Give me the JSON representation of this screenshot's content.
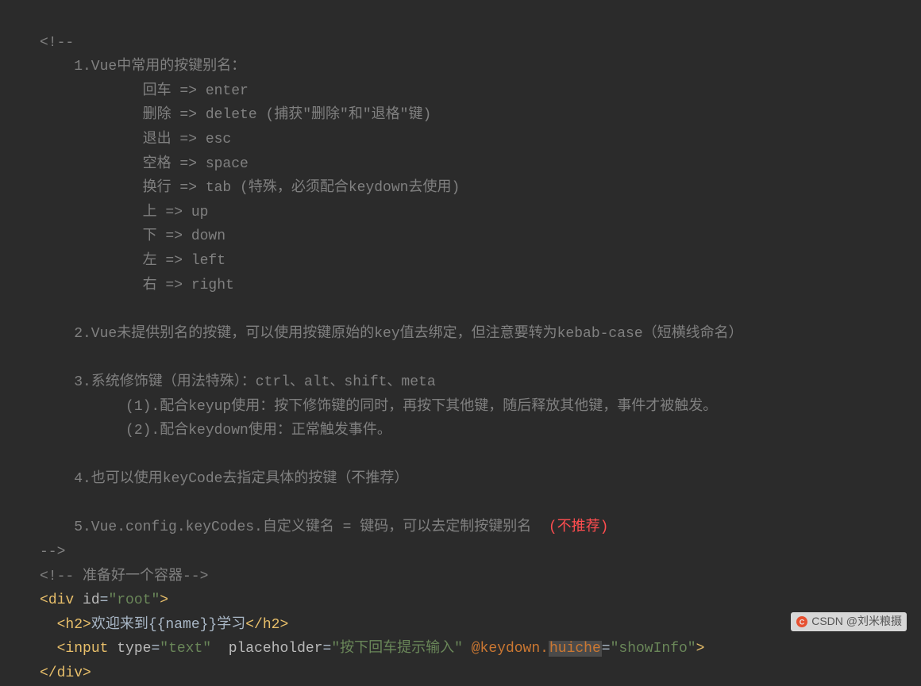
{
  "lines": {
    "l1": "<!-- ",
    "l2": "    1.Vue中常用的按键别名：",
    "l3": "            回车 => enter",
    "l4": "            删除 => delete (捕获\"删除\"和\"退格\"键)",
    "l5": "            退出 => esc",
    "l6": "            空格 => space",
    "l7": "            换行 => tab (特殊，必须配合keydown去使用)",
    "l8": "            上 => up",
    "l9": "            下 => down",
    "l10": "            左 => left",
    "l11": "            右 => right",
    "l12": "",
    "l13": "    2.Vue未提供别名的按键，可以使用按键原始的key值去绑定，但注意要转为kebab-case（短横线命名）",
    "l14": "",
    "l15": "    3.系统修饰键（用法特殊）：ctrl、alt、shift、meta",
    "l16": "          (1).配合keyup使用：按下修饰键的同时，再按下其他键，随后释放其他键，事件才被触发。",
    "l17": "          (2).配合keydown使用：正常触发事件。",
    "l18": "",
    "l19": "    4.也可以使用keyCode去指定具体的按键（不推荐）",
    "l20": "",
    "l21a": "    5.Vue.config.keyCodes.自定义键名 = 键码，可以去定制按键别名  ",
    "l21b": "(不推荐)",
    "l22": "-->",
    "l23": "<!-- 准备好一个容器-->",
    "div_open_a": "<",
    "div_open_b": "div ",
    "div_attr_id": "id",
    "div_eq": "=",
    "div_val": "\"root\"",
    "div_close": ">",
    "h2_open": "<h2>",
    "h2_text": "欢迎来到{{name}}学习",
    "h2_close": "</h2>",
    "input_open": "<input ",
    "input_type_k": "type",
    "input_type_v": "\"text\"",
    "input_ph_k": "placeholder",
    "input_ph_v": "\"按下回车提示输入\"",
    "input_dir": "@keydown.",
    "input_dir_mod": "huiche",
    "input_dir_v": "\"showInfo\"",
    "input_close": ">",
    "div_end": "</div>",
    "eq": "="
  },
  "watermark": "CSDN @刘米粮摄"
}
